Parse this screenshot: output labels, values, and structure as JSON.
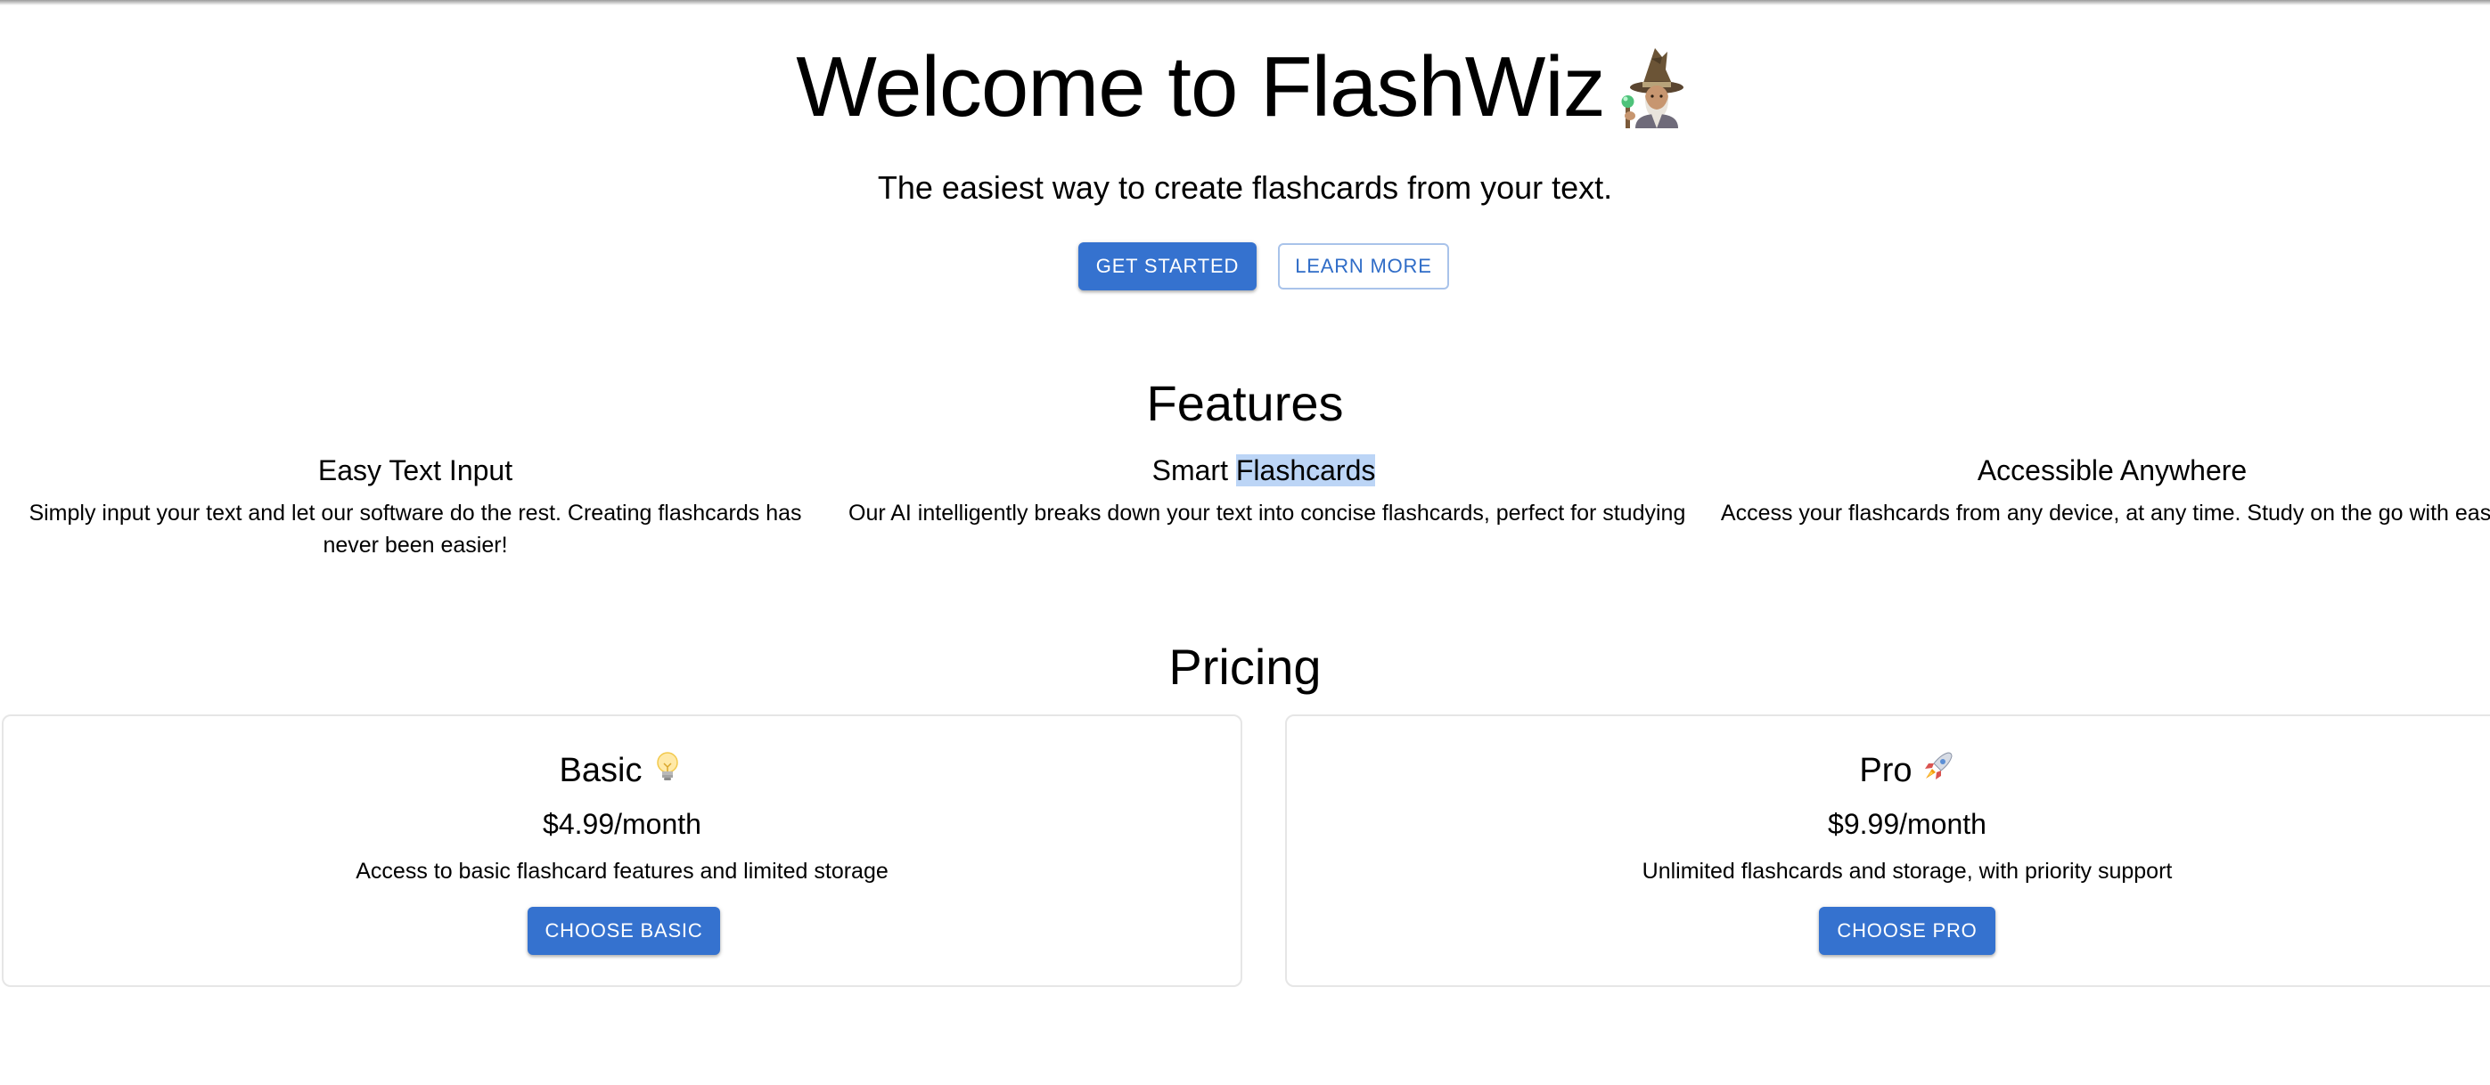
{
  "hero": {
    "title": "Welcome to FlashWiz",
    "title_icon": "wizard-icon",
    "subtitle": "The easiest way to create flashcards from your text.",
    "primary_button": "GET STARTED",
    "secondary_button": "LEARN MORE"
  },
  "features": {
    "heading": "Features",
    "items": [
      {
        "title": "Easy Text Input",
        "description": "Simply input your text and let our software do the rest. Creating flashcards has never been easier!"
      },
      {
        "title_prefix": "Smart ",
        "title_highlight": "Flashcards",
        "description": "Our AI intelligently breaks down your text into concise flashcards, perfect for studying"
      },
      {
        "title": "Accessible Anywhere",
        "description": "Access your flashcards from any device, at any time. Study on the go with ease"
      }
    ]
  },
  "pricing": {
    "heading": "Pricing",
    "plans": [
      {
        "name": "Basic",
        "icon": "lightbulb-icon",
        "price": "$4.99/month",
        "description": "Access to basic flashcard features and limited storage",
        "button": "CHOOSE BASIC"
      },
      {
        "name": "Pro",
        "icon": "rocket-icon",
        "price": "$9.99/month",
        "description": "Unlimited flashcards and storage, with priority support",
        "button": "CHOOSE PRO"
      }
    ]
  },
  "colors": {
    "primary": "#3572cf",
    "outline_border": "#a9c3ea",
    "selection_highlight": "#bcd5f6",
    "card_border": "#e6e6e6"
  }
}
